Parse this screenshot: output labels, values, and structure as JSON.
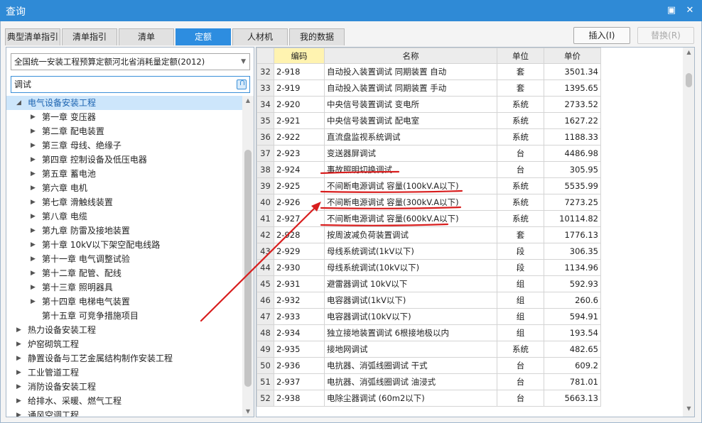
{
  "window": {
    "title": "查询",
    "colors": {
      "titlebar": "#2f8ad6",
      "accent": "#2d8de0",
      "annotation": "#d81e1e"
    }
  },
  "tabs": [
    "典型清单指引",
    "清单指引",
    "清单",
    "定额",
    "人材机",
    "我的数据"
  ],
  "active_tab": "定额",
  "actions": {
    "insert": "插入(I)",
    "replace": "替换(R)"
  },
  "left": {
    "library": "全国统一安装工程预算定额河北省消耗量定额(2012)",
    "search": "调试",
    "tree": [
      {
        "label": "电气设备安装工程",
        "level": 0,
        "expanded": true,
        "selected": true
      },
      {
        "label": "第一章  变压器",
        "level": 1
      },
      {
        "label": "第二章  配电装置",
        "level": 1
      },
      {
        "label": "第三章  母线、绝缘子",
        "level": 1
      },
      {
        "label": "第四章  控制设备及低压电器",
        "level": 1
      },
      {
        "label": "第五章  蓄电池",
        "level": 1
      },
      {
        "label": "第六章  电机",
        "level": 1
      },
      {
        "label": "第七章  滑触线装置",
        "level": 1
      },
      {
        "label": "第八章  电缆",
        "level": 1
      },
      {
        "label": "第九章  防雷及接地装置",
        "level": 1
      },
      {
        "label": "第十章  10kV以下架空配电线路",
        "level": 1
      },
      {
        "label": "第十一章  电气调整试验",
        "level": 1
      },
      {
        "label": "第十二章  配管、配线",
        "level": 1
      },
      {
        "label": "第十三章  照明器具",
        "level": 1
      },
      {
        "label": "第十四章  电梯电气装置",
        "level": 1
      },
      {
        "label": "第十五章  可竞争措施项目",
        "level": 1,
        "leaf": true
      },
      {
        "label": "热力设备安装工程",
        "level": 0
      },
      {
        "label": "炉窑砌筑工程",
        "level": 0
      },
      {
        "label": "静置设备与工艺金属结构制作安装工程",
        "level": 0
      },
      {
        "label": "工业管道工程",
        "level": 0
      },
      {
        "label": "消防设备安装工程",
        "level": 0
      },
      {
        "label": "给排水、采暖、燃气工程",
        "level": 0
      },
      {
        "label": "通风空调工程",
        "level": 0
      }
    ]
  },
  "grid": {
    "columns": [
      "编码",
      "名称",
      "单位",
      "单价"
    ],
    "rows": [
      {
        "no": "32",
        "code": "2-918",
        "name": "自动投入装置调试  同期装置  自动",
        "unit": "套",
        "price": "3501.34"
      },
      {
        "no": "33",
        "code": "2-919",
        "name": "自动投入装置调试  同期装置  手动",
        "unit": "套",
        "price": "1395.65"
      },
      {
        "no": "34",
        "code": "2-920",
        "name": "中央信号装置调试  变电所",
        "unit": "系统",
        "price": "2733.52"
      },
      {
        "no": "35",
        "code": "2-921",
        "name": "中央信号装置调试  配电室",
        "unit": "系统",
        "price": "1627.22"
      },
      {
        "no": "36",
        "code": "2-922",
        "name": "直流盘监视系统调试",
        "unit": "系统",
        "price": "1188.33"
      },
      {
        "no": "37",
        "code": "2-923",
        "name": "变送器屏调试",
        "unit": "台",
        "price": "4486.98"
      },
      {
        "no": "38",
        "code": "2-924",
        "name": "事故照明切换调试",
        "unit": "台",
        "price": "305.95"
      },
      {
        "no": "39",
        "code": "2-925",
        "name": "不间断电源调试  容量(100kV.A以下)",
        "unit": "系统",
        "price": "5535.99"
      },
      {
        "no": "40",
        "code": "2-926",
        "name": "不间断电源调试  容量(300kV.A以下)",
        "unit": "系统",
        "price": "7273.25"
      },
      {
        "no": "41",
        "code": "2-927",
        "name": "不间断电源调试  容量(600kV.A以下)",
        "unit": "系统",
        "price": "10114.82"
      },
      {
        "no": "42",
        "code": "2-928",
        "name": "按周波减负荷装置调试",
        "unit": "套",
        "price": "1776.13"
      },
      {
        "no": "43",
        "code": "2-929",
        "name": "母线系统调试(1kV以下)",
        "unit": "段",
        "price": "306.35"
      },
      {
        "no": "44",
        "code": "2-930",
        "name": "母线系统调试(10kV以下)",
        "unit": "段",
        "price": "1134.96"
      },
      {
        "no": "45",
        "code": "2-931",
        "name": "避雷器调试  10kV以下",
        "unit": "组",
        "price": "592.93"
      },
      {
        "no": "46",
        "code": "2-932",
        "name": "电容器调试(1kV以下)",
        "unit": "组",
        "price": "260.6"
      },
      {
        "no": "47",
        "code": "2-933",
        "name": "电容器调试(10kV以下)",
        "unit": "组",
        "price": "594.91"
      },
      {
        "no": "48",
        "code": "2-934",
        "name": "独立接地装置调试  6根接地极以内",
        "unit": "组",
        "price": "193.54"
      },
      {
        "no": "49",
        "code": "2-935",
        "name": "接地网调试",
        "unit": "系统",
        "price": "482.65"
      },
      {
        "no": "50",
        "code": "2-936",
        "name": "电抗器、消弧线圈调试  干式",
        "unit": "台",
        "price": "609.2"
      },
      {
        "no": "51",
        "code": "2-937",
        "name": "电抗器、消弧线圈调试  油浸式",
        "unit": "台",
        "price": "781.01"
      },
      {
        "no": "52",
        "code": "2-938",
        "name": "电除尘器调试  (60m2以下)",
        "unit": "台",
        "price": "5663.13"
      }
    ]
  },
  "icons": [
    "close-icon",
    "restore-icon",
    "caret-down-icon",
    "caret-right-icon",
    "search-go-icon",
    "scroll-thumb"
  ]
}
